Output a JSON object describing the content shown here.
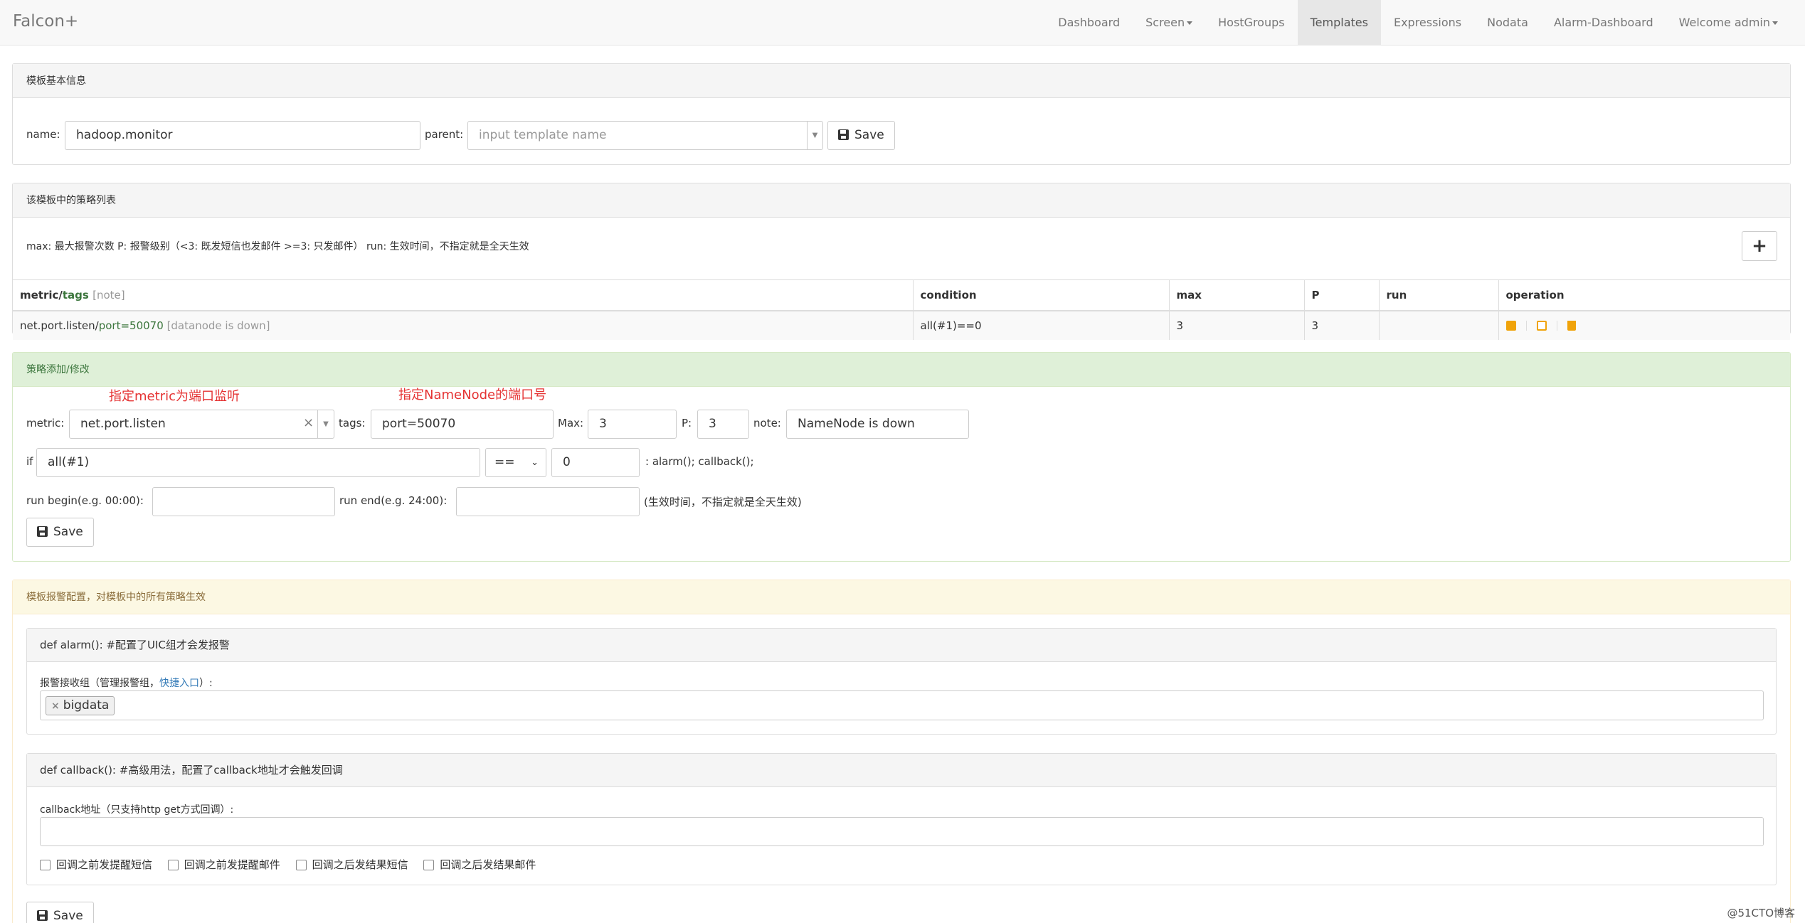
{
  "navbar": {
    "brand": "Falcon+",
    "items": [
      {
        "label": "Dashboard",
        "active": false,
        "dropdown": false
      },
      {
        "label": "Screen",
        "active": false,
        "dropdown": true
      },
      {
        "label": "HostGroups",
        "active": false,
        "dropdown": false
      },
      {
        "label": "Templates",
        "active": true,
        "dropdown": false
      },
      {
        "label": "Expressions",
        "active": false,
        "dropdown": false
      },
      {
        "label": "Nodata",
        "active": false,
        "dropdown": false
      },
      {
        "label": "Alarm-Dashboard",
        "active": false,
        "dropdown": false
      },
      {
        "label": "Welcome admin",
        "active": false,
        "dropdown": true
      }
    ]
  },
  "basic": {
    "title": "模板基本信息",
    "name_label": "name:",
    "name_value": "hadoop.monitor",
    "parent_label": "parent:",
    "parent_placeholder": "input template name",
    "save_label": "Save"
  },
  "strategies": {
    "title": "该模板中的策略列表",
    "legend": "max: 最大报警次数 P: 报警级别（<3: 既发短信也发邮件 >=3: 只发邮件） run: 生效时间，不指定就是全天生效",
    "add_symbol": "+",
    "headers": {
      "metric": "metric/",
      "tags": "tags",
      "note": "[note]",
      "condition": "condition",
      "max": "max",
      "p": "P",
      "run": "run",
      "operation": "operation"
    },
    "rows": [
      {
        "metric": "net.port.listen/",
        "tags": "port=50070",
        "note": "[datanode is down]",
        "condition": "all(#1)==0",
        "max": "3",
        "p": "3",
        "run": ""
      }
    ]
  },
  "edit": {
    "title": "策略添加/修改",
    "annotation_metric": "指定metric为端口监听",
    "annotation_tags": "指定NameNode的端口号",
    "metric_label": "metric:",
    "metric_value": "net.port.listen",
    "clear_symbol": "×",
    "tags_label": "tags:",
    "tags_value": "port=50070",
    "max_label": "Max:",
    "max_value": "3",
    "p_label": "P:",
    "p_value": "3",
    "note_label": "note:",
    "note_value": "NameNode is down",
    "if_label": "if",
    "func_value": "all(#1)",
    "op_value": "==",
    "threshold_value": "0",
    "action_text": ": alarm(); callback();",
    "run_begin_label": "run begin(e.g. 00:00):",
    "run_end_label": "run end(e.g. 24:00):",
    "run_hint": "(生效时间，不指定就是全天生效)",
    "save_label": "Save"
  },
  "alarm": {
    "title": "模板报警配置，对模板中的所有策略生效",
    "alarm_head": "def alarm(): #配置了UIC组才会发报警",
    "receiver_label_prefix": "报警接收组（管理报警组，",
    "receiver_link": "快捷入口",
    "receiver_label_suffix": "）:",
    "tag_remove": "×",
    "tag_value": "bigdata",
    "callback_head": "def callback(): #高级用法，配置了callback地址才会触发回调",
    "callback_label": "callback地址（只支持http get方式回调）:",
    "checkboxes": [
      "回调之前发提醒短信",
      "回调之前发提醒邮件",
      "回调之后发结果短信",
      "回调之后发结果邮件"
    ],
    "save_label": "Save"
  },
  "watermark": "@51CTO博客"
}
